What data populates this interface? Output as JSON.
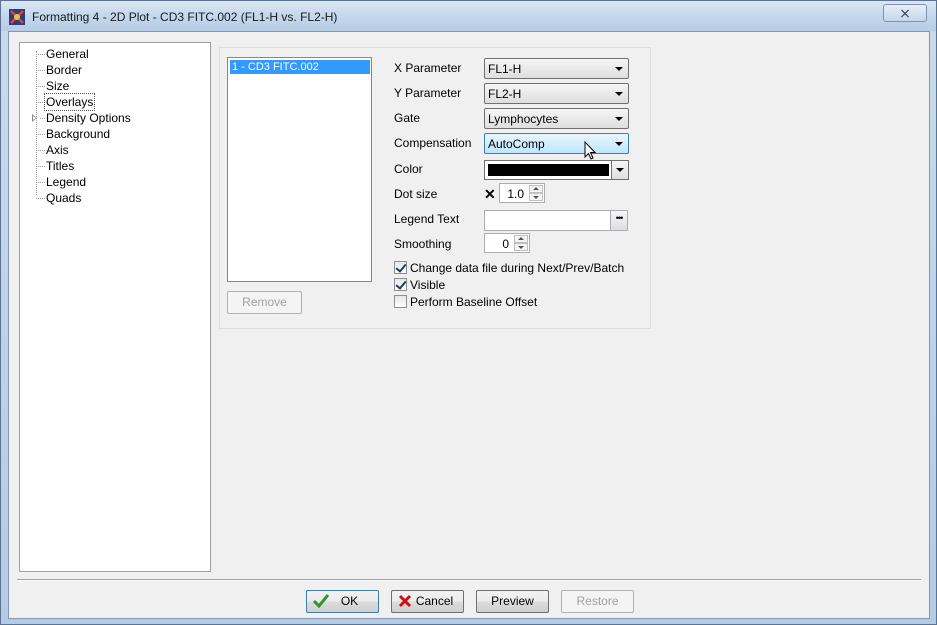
{
  "window": {
    "title": "Formatting 4 - 2D Plot - CD3 FITC.002 (FL1-H vs. FL2-H)",
    "close_label": "⨯"
  },
  "tree": {
    "items": [
      {
        "label": "General",
        "selected": false,
        "expandable": false
      },
      {
        "label": "Border",
        "selected": false,
        "expandable": false
      },
      {
        "label": "Size",
        "selected": false,
        "expandable": false
      },
      {
        "label": "Overlays",
        "selected": true,
        "expandable": false
      },
      {
        "label": "Density Options",
        "selected": false,
        "expandable": true
      },
      {
        "label": "Background",
        "selected": false,
        "expandable": false
      },
      {
        "label": "Axis",
        "selected": false,
        "expandable": false
      },
      {
        "label": "Titles",
        "selected": false,
        "expandable": false
      },
      {
        "label": "Legend",
        "selected": false,
        "expandable": false
      },
      {
        "label": "Quads",
        "selected": false,
        "expandable": false
      }
    ]
  },
  "overlays": {
    "list_items": [
      "1 - CD3 FITC.002"
    ],
    "remove_label": "Remove"
  },
  "form": {
    "x_parameter": {
      "label": "X Parameter",
      "value": "FL1-H"
    },
    "y_parameter": {
      "label": "Y Parameter",
      "value": "FL2-H"
    },
    "gate": {
      "label": "Gate",
      "value": "Lymphocytes"
    },
    "compensation": {
      "label": "Compensation",
      "value": "AutoComp"
    },
    "color": {
      "label": "Color",
      "value": "#000000"
    },
    "dot_size": {
      "label": "Dot size",
      "value": "1.0"
    },
    "legend_text": {
      "label": "Legend Text",
      "value": ""
    },
    "smoothing": {
      "label": "Smoothing",
      "value": "0"
    },
    "checks": [
      {
        "label": "Change data file during Next/Prev/Batch",
        "checked": true
      },
      {
        "label": "Visible",
        "checked": true
      },
      {
        "label": "Perform Baseline Offset",
        "checked": false
      }
    ]
  },
  "footer": {
    "ok_label": "OK",
    "cancel_label": "Cancel",
    "preview_label": "Preview",
    "restore_label": "Restore"
  },
  "colors": {
    "selection": "#3399ff",
    "ok_check": "#2a9a2a",
    "cancel_x": "#cc1111"
  }
}
